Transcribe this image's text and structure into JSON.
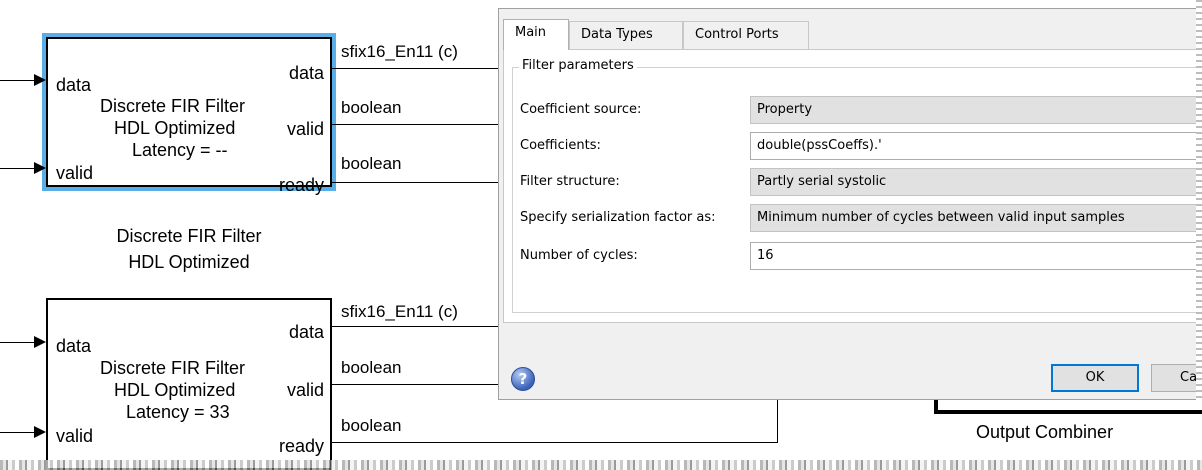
{
  "block1": {
    "port_in_data": "data",
    "port_in_valid": "valid",
    "title_line1": "Discrete FIR Filter",
    "title_line2": "HDL Optimized",
    "latency": "Latency = --",
    "port_out_data": "data",
    "port_out_valid": "valid",
    "port_out_ready": "ready",
    "caption_line1": "Discrete FIR Filter",
    "caption_line2": "HDL Optimized",
    "sig_data": "sfix16_En11 (c)",
    "sig_valid": "boolean",
    "sig_ready": "boolean"
  },
  "block2": {
    "port_in_data": "data",
    "port_in_valid": "valid",
    "title_line1": "Discrete FIR Filter",
    "title_line2": "HDL Optimized",
    "latency": "Latency = 33",
    "port_out_data": "data",
    "port_out_valid": "valid",
    "port_out_ready": "ready",
    "sig_data": "sfix16_En11 (c)",
    "sig_valid": "boolean",
    "sig_ready": "boolean"
  },
  "output_combiner_label": "Output Combiner",
  "dialog": {
    "tabs": [
      {
        "label": "Main",
        "active": true
      },
      {
        "label": "Data Types",
        "active": false
      },
      {
        "label": "Control Ports",
        "active": false
      }
    ],
    "group_title": "Filter parameters",
    "params": [
      {
        "label": "Coefficient source:",
        "value": "Property",
        "kind": "dropdown"
      },
      {
        "label": "Coefficients:",
        "value": "double(pssCoeffs).'",
        "kind": "text"
      },
      {
        "label": "Filter structure:",
        "value": "Partly serial systolic",
        "kind": "dropdown"
      },
      {
        "label": "Specify serialization factor as:",
        "value": "Minimum number of cycles between valid input samples",
        "kind": "dropdown"
      },
      {
        "label": "Number of cycles:",
        "value": "16",
        "kind": "text"
      }
    ],
    "help_glyph": "?",
    "ok_label": "OK",
    "cancel_label": "Can",
    "accent_color": "#0078d7"
  },
  "selection_color": "#5aaee8"
}
